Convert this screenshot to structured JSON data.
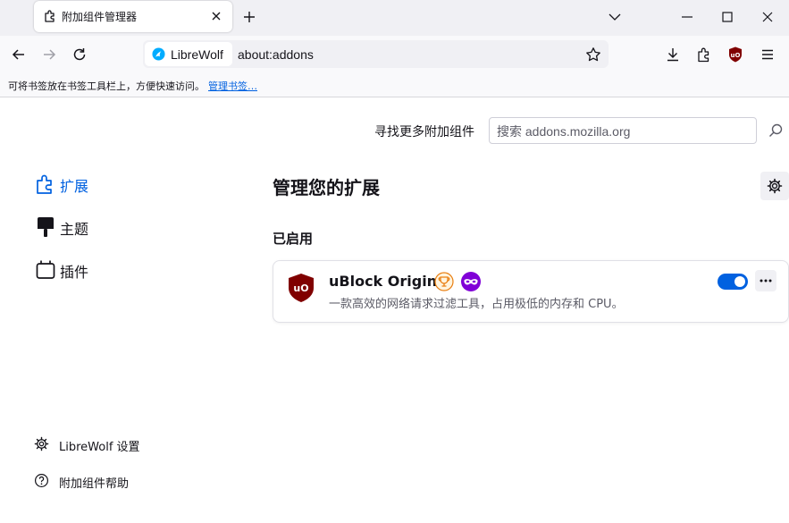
{
  "tab": {
    "title": "附加组件管理器",
    "icon": "puzzle-icon",
    "close_icon": "close-icon"
  },
  "window_controls": {
    "list_all_tabs": "chevron-down-icon",
    "minimize": "minimize-icon",
    "maximize": "maximize-icon",
    "close": "close-icon"
  },
  "navbar": {
    "back_icon": "back-arrow-icon",
    "forward_icon": "forward-arrow-icon",
    "reload_icon": "reload-icon",
    "identity_label": "LibreWolf",
    "url": "about:addons",
    "right_icons": [
      "download-icon",
      "extensions-icon",
      "ublock-origin-icon",
      "hamburger-menu-icon"
    ]
  },
  "bookmarks_bar": {
    "text": "可将书签放在书签工具栏上，方便快速访问。",
    "link": "管理书签…"
  },
  "search": {
    "label": "寻找更多附加组件",
    "placeholder": "搜索 addons.mozilla.org"
  },
  "categories": [
    {
      "label": "扩展",
      "icon": "puzzle-icon",
      "selected": true
    },
    {
      "label": "主题",
      "icon": "brush-icon",
      "selected": false
    },
    {
      "label": "插件",
      "icon": "plugin-icon",
      "selected": false
    }
  ],
  "main": {
    "heading": "管理您的扩展",
    "enabled_section": "已启用"
  },
  "extension": {
    "name": "uBlock Origin",
    "description": "一款高效的网络请求过滤工具，占用极低的内存和 CPU。",
    "enabled": true,
    "badges": [
      "recommended-trophy-icon",
      "private-browsing-mask-icon"
    ]
  },
  "footer": [
    {
      "label": "LibreWolf 设置",
      "icon": "gear-icon"
    },
    {
      "label": "附加组件帮助",
      "icon": "help-icon"
    }
  ],
  "colors": {
    "accent": "#0061e0",
    "ublock_red": "#800000",
    "private_purple": "#8000d7",
    "recommended_orange": "#e97f12"
  }
}
